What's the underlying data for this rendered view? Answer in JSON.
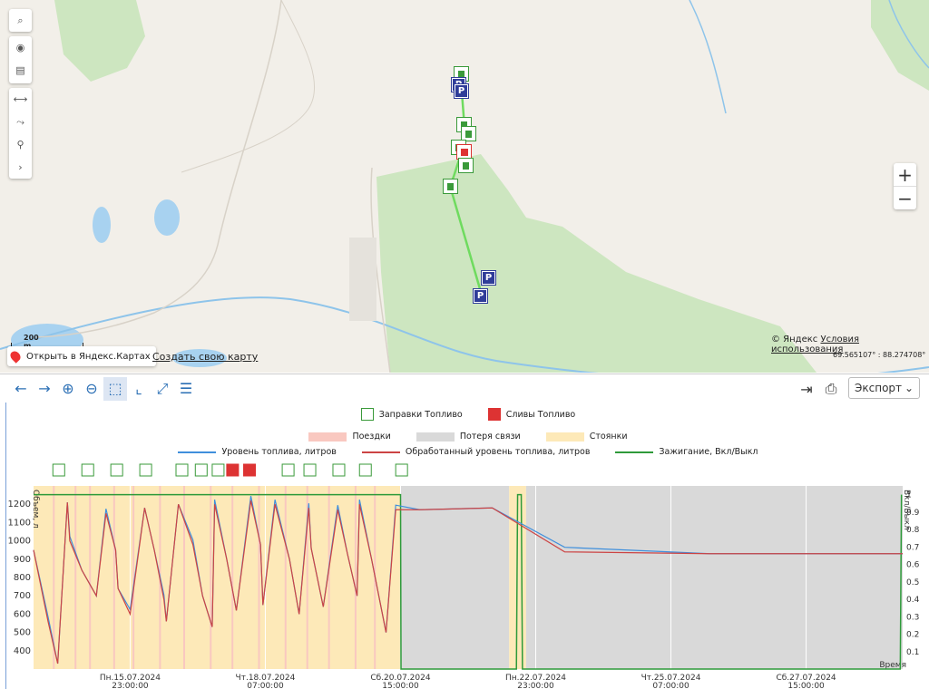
{
  "map": {
    "scale_label": "200 m",
    "open_yandex_label": "Открыть в Яндекс.Картах",
    "create_map_label": "Создать свою карту",
    "copyright": "© Яндекс",
    "terms_label": "Условия использования",
    "coords": "69.565107° : 88.274708°",
    "toolbar_icons": [
      "search-icon",
      "eye-icon",
      "map-icon",
      "ruler-icon",
      "route-icon",
      "pins-icon",
      "chevron-right-icon"
    ],
    "zoom_in": "+",
    "zoom_out": "−",
    "markers": [
      {
        "type": "fuel"
      },
      {
        "type": "park",
        "label": "P"
      },
      {
        "type": "drain"
      }
    ]
  },
  "toolbar": {
    "icons": [
      "arrow-left-icon",
      "arrow-right-icon",
      "zoom-in-icon",
      "zoom-out-icon",
      "select-zoom-icon",
      "reset-x-icon",
      "fit-icon",
      "list-icon"
    ],
    "export_label": "Экспорт",
    "right_icons": [
      "import-icon",
      "print-icon"
    ]
  },
  "legend": {
    "events": [
      "Заправки Топливо",
      "Сливы Топливо"
    ],
    "states": [
      "Поездки",
      "Потеря связи",
      "Стоянки"
    ],
    "lines": [
      "Уровень топлива, литров",
      "Обработанный уровень топлива, литров",
      "Зажигание, Вкл/Выкл"
    ]
  },
  "colors": {
    "trips": "#f9c8c0",
    "no_connection": "#d9d9d9",
    "parking": "#fde9b8",
    "fuel_level": "#3f8fdc",
    "processed": "#cc4444",
    "ignition": "#2e9a3a"
  },
  "chart_data": {
    "type": "line",
    "y_left_label": "Объем, л",
    "y_right_label": "Вкл/Выкл",
    "x_label": "Время",
    "y_left_ticks": [
      400,
      500,
      600,
      700,
      800,
      900,
      1000,
      1100,
      1200
    ],
    "y_right_ticks": [
      0.1,
      0.2,
      0.3,
      0.4,
      0.5,
      0.6,
      0.7,
      0.8,
      0.9,
      1
    ],
    "y_right_tick_labels": [
      "0.1",
      "0.2",
      "0.3",
      "0.4",
      "0.5",
      "0.6",
      "0.7",
      "0.8",
      "0.9",
      "1"
    ],
    "x_tick_labels": [
      {
        "date": "Пн.15.07.2024",
        "time": "23:00:00"
      },
      {
        "date": "Чт.18.07.2024",
        "time": "07:00:00"
      },
      {
        "date": "Сб.20.07.2024",
        "time": "15:00:00"
      },
      {
        "date": "Пн.22.07.2024",
        "time": "23:00:00"
      },
      {
        "date": "Чт.25.07.2024",
        "time": "07:00:00"
      },
      {
        "date": "Сб.27.07.2024",
        "time": "15:00:00"
      }
    ],
    "series": [
      {
        "name": "Обработанный уровень топлива, литров",
        "x": [
          0,
          0.6,
          1.0,
          1.4,
          1.5,
          2.0,
          2.6,
          3.0,
          3.4,
          3.5,
          4.0,
          4.6,
          5.0,
          5.4,
          5.5,
          6.0,
          6.6,
          7.0,
          7.4,
          7.5,
          8.0,
          8.4,
          9.0,
          9.4,
          9.5,
          10.0,
          10.6,
          11.0,
          11.4,
          11.5,
          12.0,
          12.6,
          13.0,
          13.4,
          13.5,
          14.0,
          14.6,
          15.0,
          16.0,
          19.0,
          22.0,
          28.0,
          36.0
        ],
        "y": [
          950,
          560,
          330,
          1210,
          1000,
          840,
          700,
          1150,
          950,
          740,
          600,
          1180,
          950,
          680,
          560,
          1200,
          980,
          700,
          530,
          1200,
          900,
          620,
          1220,
          980,
          650,
          1200,
          900,
          600,
          1180,
          960,
          640,
          1170,
          930,
          700,
          1200,
          900,
          500,
          1170,
          1170,
          1180,
          940,
          930,
          930
        ]
      }
    ]
  }
}
